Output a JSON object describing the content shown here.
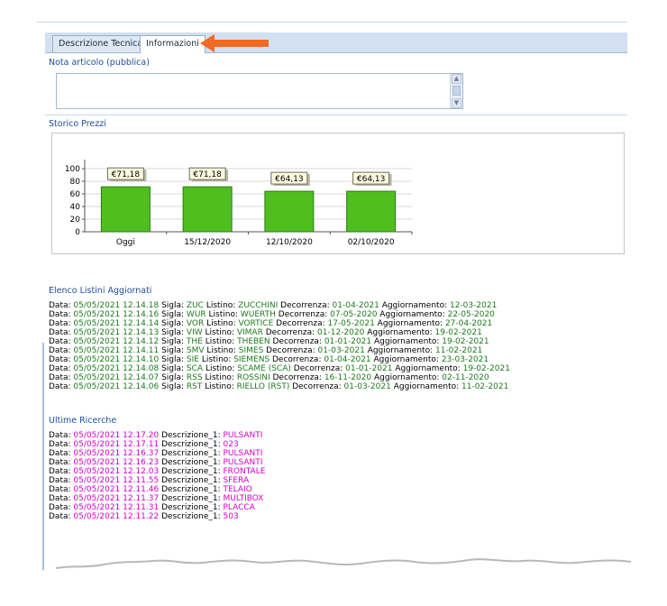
{
  "tabs": [
    {
      "label": "Descrizione Tecnica",
      "active": false
    },
    {
      "label": "Informazioni",
      "active": true
    }
  ],
  "nota": {
    "label": "Nota articolo (pubblica)",
    "value": ""
  },
  "storico": {
    "label": "Storico Prezzi"
  },
  "chart_data": {
    "type": "bar",
    "categories": [
      "Oggi",
      "15/12/2020",
      "12/10/2020",
      "02/10/2020"
    ],
    "values": [
      71.18,
      71.18,
      64.13,
      64.13
    ],
    "data_labels": [
      "€71,18",
      "€71,18",
      "€64,13",
      "€64,13"
    ],
    "yticks": [
      0,
      20,
      40,
      60,
      80,
      100
    ],
    "ylim": [
      0,
      110
    ],
    "grid": true,
    "bar_color": "#4ebf1f"
  },
  "listini": {
    "title": "Elenco Listini Aggiornati",
    "labels": {
      "data": "Data:",
      "sigla": "Sigla:",
      "listino": "Listino:",
      "decorrenza": "Decorrenza:",
      "aggiornamento": "Aggiornamento:"
    },
    "rows": [
      {
        "data": "05/05/2021 12.14.18",
        "sigla": "ZUC",
        "listino": "ZUCCHINI",
        "decorrenza": "01-04-2021",
        "aggiornamento": "12-03-2021"
      },
      {
        "data": "05/05/2021 12.14.16",
        "sigla": "WUR",
        "listino": "WUERTH",
        "decorrenza": "07-05-2020",
        "aggiornamento": "22-05-2020"
      },
      {
        "data": "05/05/2021 12.14.14",
        "sigla": "VOR",
        "listino": "VORTICE",
        "decorrenza": "17-05-2021",
        "aggiornamento": "27-04-2021"
      },
      {
        "data": "05/05/2021 12.14.13",
        "sigla": "VIW",
        "listino": "VIMAR",
        "decorrenza": "01-12-2020",
        "aggiornamento": "19-02-2021"
      },
      {
        "data": "05/05/2021 12.14.12",
        "sigla": "THE",
        "listino": "THEBEN",
        "decorrenza": "01-01-2021",
        "aggiornamento": "19-02-2021"
      },
      {
        "data": "05/05/2021 12.14.11",
        "sigla": "SMV",
        "listino": "SIMES",
        "decorrenza": "01-03-2021",
        "aggiornamento": "11-02-2021"
      },
      {
        "data": "05/05/2021 12.14.10",
        "sigla": "SIE",
        "listino": "SIEMENS",
        "decorrenza": "01-04-2021",
        "aggiornamento": "23-03-2021"
      },
      {
        "data": "05/05/2021 12.14.08",
        "sigla": "SCA",
        "listino": "SCAME (SCA)",
        "decorrenza": "01-01-2021",
        "aggiornamento": "19-02-2021"
      },
      {
        "data": "05/05/2021 12.14.07",
        "sigla": "RSS",
        "listino": "ROSSINI",
        "decorrenza": "16-11-2020",
        "aggiornamento": "02-11-2020"
      },
      {
        "data": "05/05/2021 12.14.06",
        "sigla": "RST",
        "listino": "RIELLO (RST)",
        "decorrenza": "01-03-2021",
        "aggiornamento": "11-02-2021"
      }
    ]
  },
  "ricerche": {
    "title": "Ultime Ricerche",
    "labels": {
      "data": "Data:",
      "descrizione": "Descrizione_1:"
    },
    "rows": [
      {
        "data": "05/05/2021 12.17.20",
        "descrizione": "PULSANTI"
      },
      {
        "data": "05/05/2021 12.17.11",
        "descrizione": "023"
      },
      {
        "data": "05/05/2021 12.16.37",
        "descrizione": "PULSANTI"
      },
      {
        "data": "05/05/2021 12.16.23",
        "descrizione": "PULSANTI"
      },
      {
        "data": "05/05/2021 12.12.03",
        "descrizione": "FRONTALE"
      },
      {
        "data": "05/05/2021 12.11.55",
        "descrizione": "SFERA"
      },
      {
        "data": "05/05/2021 12.11.46",
        "descrizione": "TELAIO"
      },
      {
        "data": "05/05/2021 12.11.37",
        "descrizione": "MULTIBOX"
      },
      {
        "data": "05/05/2021 12.11.31",
        "descrizione": "PLACCA"
      },
      {
        "data": "05/05/2021 12.11.22",
        "descrizione": "503"
      }
    ]
  },
  "colors": {
    "accent_arrow": "#f26a21",
    "section_title": "#1f4e9a",
    "listino_value": "#1d7a1d",
    "ricerca_value": "#d400c8"
  },
  "icons": {
    "arrow": "arrow-left-icon",
    "scroll_up": "scroll-up-icon",
    "scroll_down": "scroll-down-icon"
  }
}
